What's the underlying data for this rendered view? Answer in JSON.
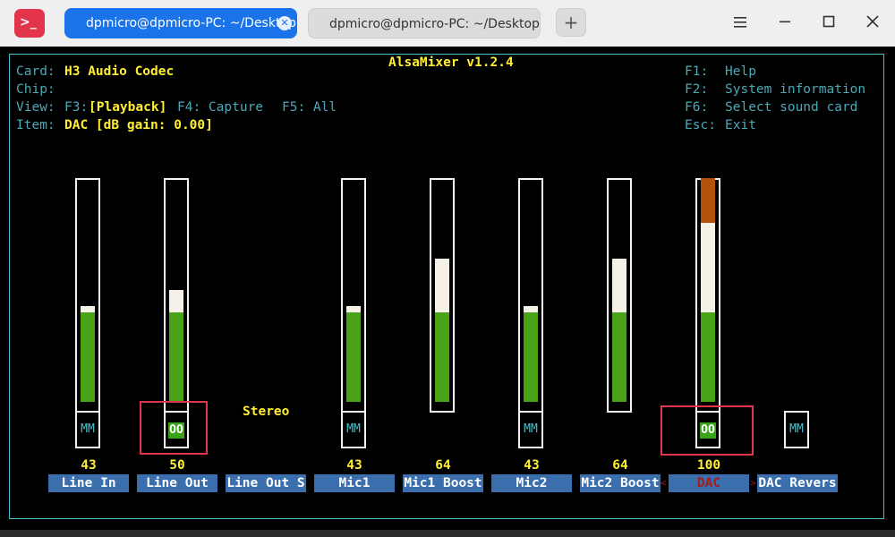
{
  "window": {
    "tabs": [
      {
        "label": "dpmicro@dpmicro-PC: ~/Desktop",
        "active": true
      },
      {
        "label": "dpmicro@dpmicro-PC: ~/Desktop",
        "active": false
      }
    ],
    "app_icon": "terminal-icon",
    "new_tab_icon": "+",
    "colors": {
      "accent": "#1a73e8",
      "app_icon": "#e2344a"
    }
  },
  "mixer": {
    "title": "AlsaMixer v1.2.4",
    "card_label": "Card:",
    "card_value": "H3 Audio Codec",
    "chip_label": "Chip:",
    "view_label": "View:",
    "view_f3_key": "F3:",
    "view_playback": "[Playback]",
    "view_f4": "F4: Capture",
    "view_f5": "F5: All",
    "item_label": "Item:",
    "item_value": "DAC [dB gain: 0.00]",
    "help": [
      {
        "key": "F1:",
        "text": "Help"
      },
      {
        "key": "F2:",
        "text": "System information"
      },
      {
        "key": "F6:",
        "text": "Select sound card"
      },
      {
        "key": "Esc:",
        "text": "Exit"
      }
    ],
    "stereo_label": "Stereo",
    "controls": [
      {
        "name": "Line In",
        "value": "43",
        "level": 0.43,
        "switch": "MM"
      },
      {
        "name": "Line Out",
        "value": "50",
        "level": 0.5,
        "switch": "OO"
      },
      {
        "name": "Line Out S",
        "value": "",
        "level": null,
        "switch": ""
      },
      {
        "name": "Mic1",
        "value": "43",
        "level": 0.43,
        "switch": "MM"
      },
      {
        "name": "Mic1 Boost",
        "value": "64",
        "level": 0.64,
        "switch": ""
      },
      {
        "name": "Mic2",
        "value": "43",
        "level": 0.43,
        "switch": "MM"
      },
      {
        "name": "Mic2 Boost",
        "value": "64",
        "level": 0.64,
        "switch": ""
      },
      {
        "name": "DAC",
        "value": "100",
        "level": 1.0,
        "switch": "OO",
        "selected": true
      },
      {
        "name": "DAC Revers",
        "value": "",
        "level": null,
        "switch": "MM"
      }
    ],
    "colors": {
      "frame": "#49c2d0",
      "highlight": "#ffee33",
      "bar_low": "#4aa217",
      "bar_mid": "#f5f1e7",
      "bar_high": "#b3500b",
      "label_bg": "#3a6ead",
      "selected_text": "#a61b1b"
    }
  }
}
